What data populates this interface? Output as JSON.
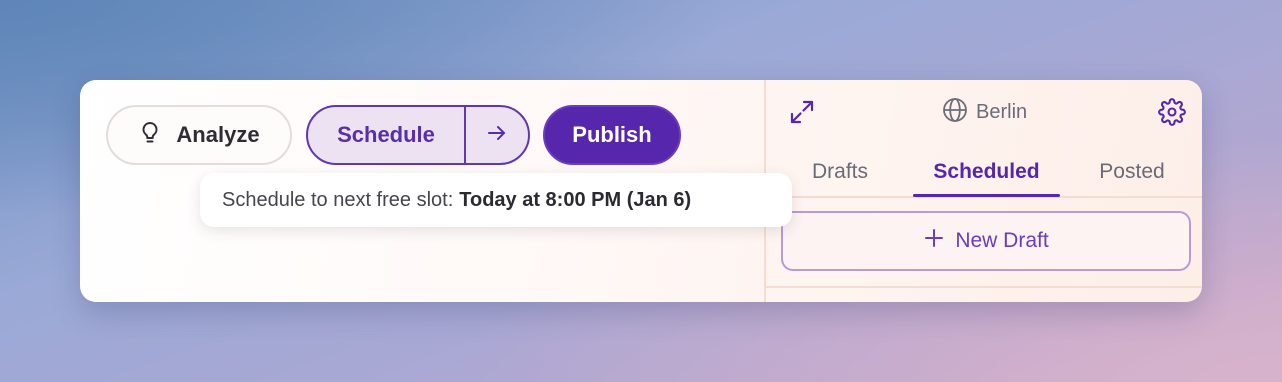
{
  "toolbar": {
    "analyze_label": "Analyze",
    "schedule_label": "Schedule",
    "publish_label": "Publish"
  },
  "tooltip": {
    "prefix": "Schedule to next free slot:",
    "slot": "Today at 8:00 PM (Jan 6)"
  },
  "panel": {
    "location": "Berlin",
    "tabs": [
      {
        "label": "Drafts",
        "active": false
      },
      {
        "label": "Scheduled",
        "active": true
      },
      {
        "label": "Posted",
        "active": false
      }
    ],
    "new_draft_label": "New Draft"
  },
  "icons": {
    "analyze": "lightbulb-icon",
    "schedule_next": "arrow-right-icon",
    "expand": "expand-icon",
    "location": "globe-icon",
    "settings": "gear-icon",
    "new_draft": "plus-icon"
  },
  "colors": {
    "accent": "#5626ad",
    "accent_light": "#ece2f2",
    "card_bg": "#fff9f7"
  }
}
